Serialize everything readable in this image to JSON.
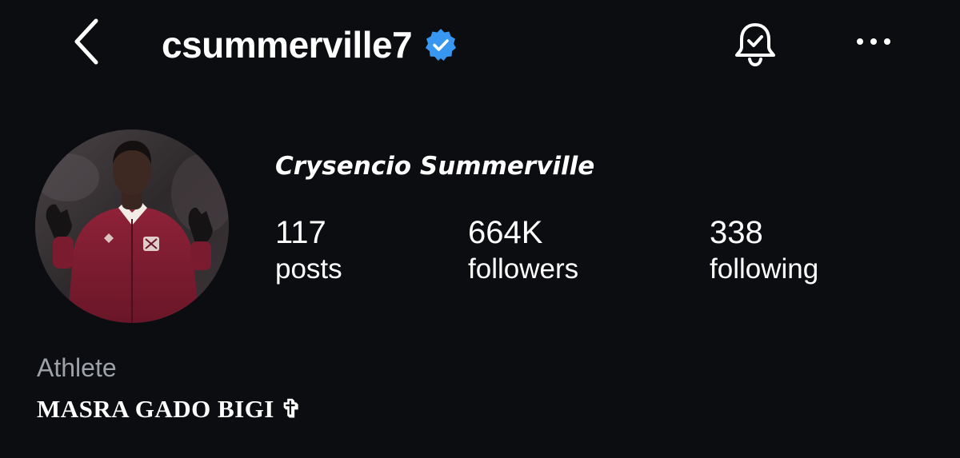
{
  "header": {
    "back_icon": "chevron-left-icon",
    "username": "csummerville7",
    "verified_icon": "verified-badge-icon",
    "verified_color": "#3897f0",
    "notifications_icon": "bell-check-icon",
    "more_icon": "more-horizontal-icon"
  },
  "profile": {
    "avatar_icon": "profile-avatar",
    "full_name": "Crysencio Summerville",
    "stats": {
      "posts": {
        "value": "117",
        "label": "posts"
      },
      "followers": {
        "value": "664K",
        "label": "followers"
      },
      "following": {
        "value": "338",
        "label": "following"
      }
    },
    "category": "Athlete",
    "bio": "MASRA GADO BIGI ✞"
  },
  "colors": {
    "background": "#0b0d11",
    "text": "#ffffff",
    "muted_text": "#9ea1a8",
    "accent": "#3897f0"
  }
}
